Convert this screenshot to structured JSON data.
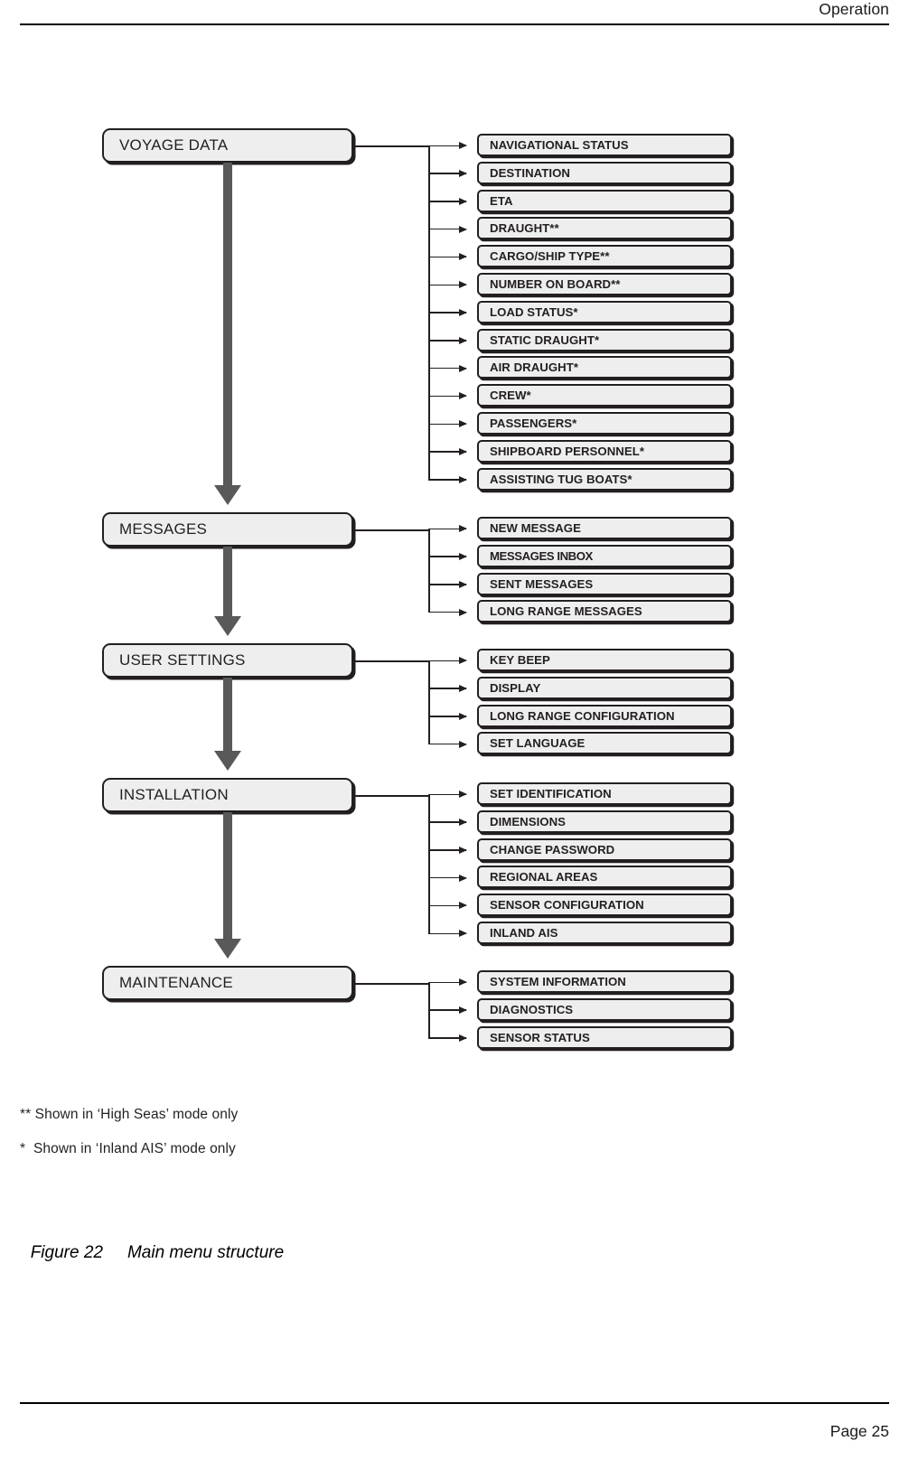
{
  "page": {
    "header_title": "Operation",
    "footer_text": "Page 25"
  },
  "figure": {
    "number": "Figure 22",
    "title": "Main menu structure"
  },
  "footnotes": [
    "** Shown in ‘High Seas’ mode only",
    "*  Shown in ‘Inland AIS’ mode only"
  ],
  "colors": {
    "box_fill": "#eeeeee",
    "box_stroke": "#231f20",
    "thick_arrow": "#595959",
    "text": "#231f20"
  },
  "menu": [
    {
      "id": "voyage-data",
      "label": "VOYAGE DATA",
      "children": [
        "NAVIGATIONAL STATUS",
        "DESTINATION",
        "ETA",
        "DRAUGHT**",
        "CARGO/SHIP TYPE**",
        "NUMBER ON BOARD**",
        "LOAD STATUS*",
        "STATIC DRAUGHT*",
        "AIR DRAUGHT*",
        "CREW*",
        "PASSENGERS*",
        "SHIPBOARD PERSONNEL*",
        "ASSISTING TUG BOATS*"
      ]
    },
    {
      "id": "messages",
      "label": "MESSAGES",
      "children": [
        "NEW MESSAGE",
        "MESSAGES INBOX",
        "SENT MESSAGES",
        "LONG RANGE MESSAGES"
      ]
    },
    {
      "id": "user-settings",
      "label": "USER SETTINGS",
      "children": [
        "KEY BEEP",
        "DISPLAY",
        "LONG RANGE CONFIGURATION",
        "SET LANGUAGE"
      ]
    },
    {
      "id": "installation",
      "label": "INSTALLATION",
      "children": [
        "SET IDENTIFICATION",
        "DIMENSIONS",
        "CHANGE PASSWORD",
        "REGIONAL AREAS",
        "SENSOR CONFIGURATION",
        "INLAND AIS"
      ]
    },
    {
      "id": "maintenance",
      "label": "MAINTENANCE",
      "children": [
        "SYSTEM INFORMATION",
        "DIAGNOSTICS",
        "SENSOR STATUS"
      ]
    }
  ]
}
